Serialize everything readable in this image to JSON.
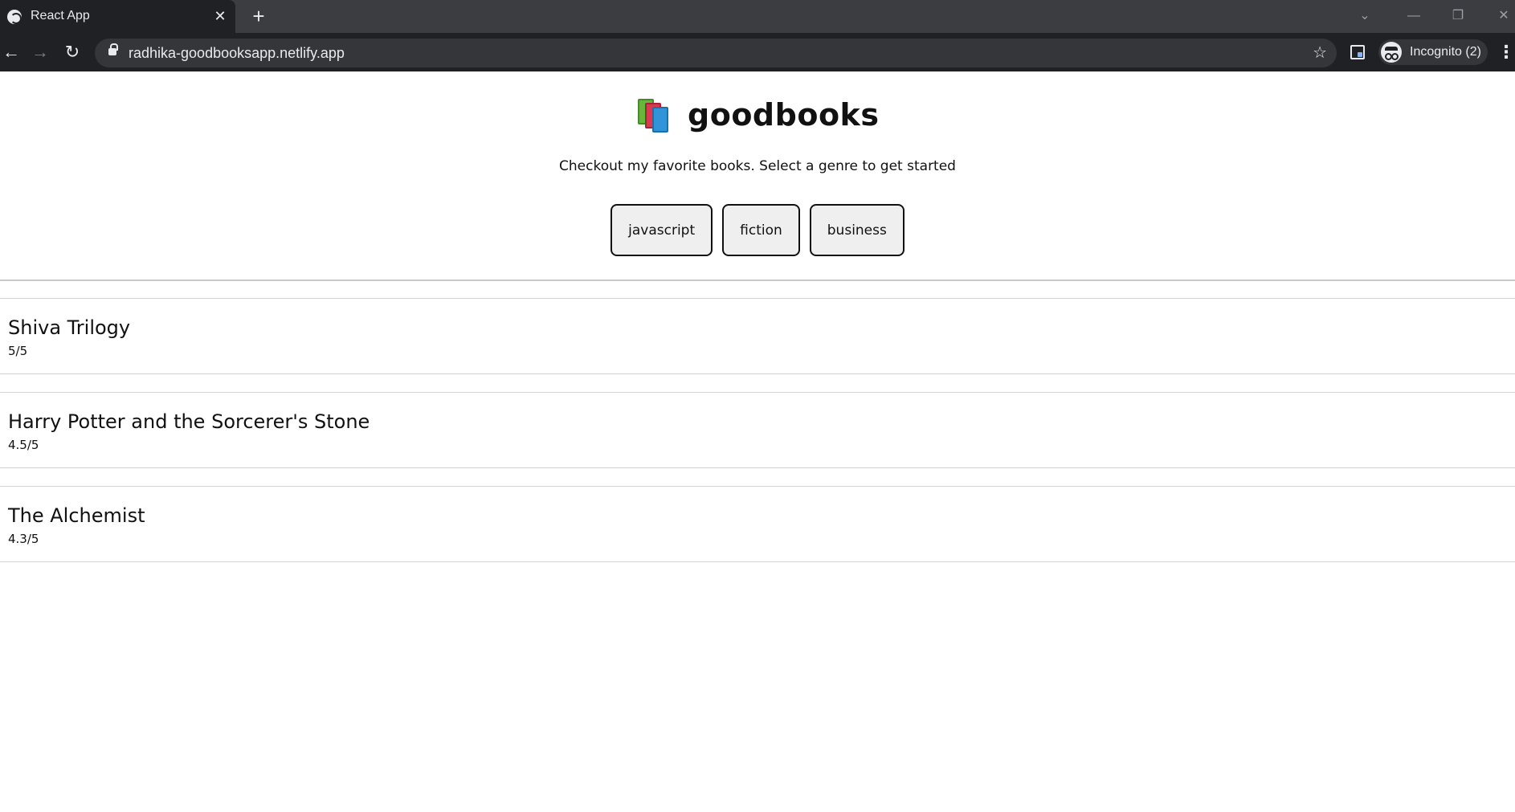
{
  "browser": {
    "tab_title": "React App",
    "url": "radhika-goodbooksapp.netlify.app",
    "profile_label": "Incognito (2)"
  },
  "app": {
    "title": "goodbooks",
    "subtitle": "Checkout my favorite books. Select a genre to get started",
    "genres": [
      "javascript",
      "fiction",
      "business"
    ]
  },
  "books": [
    {
      "name": "Shiva Trilogy",
      "rating": "5/5"
    },
    {
      "name": "Harry Potter and the Sorcerer's Stone",
      "rating": "4.5/5"
    },
    {
      "name": "The Alchemist",
      "rating": "4.3/5"
    }
  ]
}
